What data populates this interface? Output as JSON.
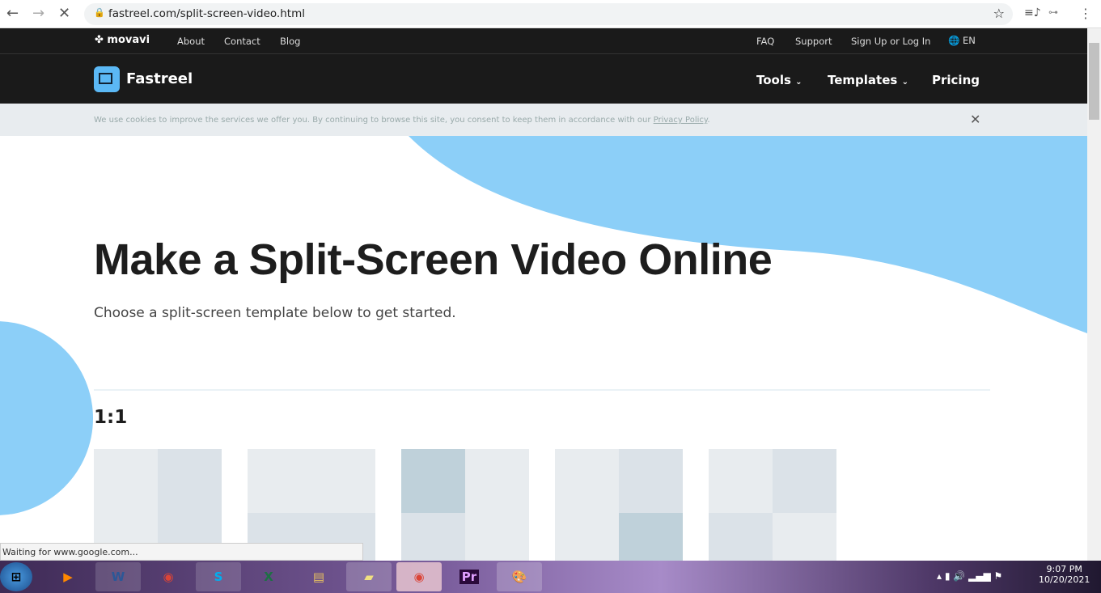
{
  "browser": {
    "url": "fastreel.com/split-screen-video.html",
    "status": "Waiting for www.google.com..."
  },
  "topnav": {
    "logo": "movavi",
    "links": [
      "About",
      "Contact",
      "Blog"
    ],
    "right_links": [
      "FAQ",
      "Support",
      "Sign Up or Log In"
    ],
    "language": "EN"
  },
  "mainnav": {
    "brand": "Fastreel",
    "items": [
      {
        "label": "Tools",
        "dropdown": true
      },
      {
        "label": "Templates",
        "dropdown": true
      },
      {
        "label": "Pricing",
        "dropdown": false
      }
    ]
  },
  "cookie": {
    "text": "We use cookies to improve the services we offer you. By continuing to browse this site, you consent to keep them in accordance with our ",
    "link": "Privacy Policy",
    "suffix": "."
  },
  "hero": {
    "title": "Make a Split-Screen Video Online",
    "subtitle": "Choose a split-screen template below to get started."
  },
  "section": {
    "title": "1:1"
  },
  "colors": {
    "accent": "#8ccff8",
    "dark": "#1a1a1a",
    "tile_light": "#e8ecef",
    "tile_mid": "#dbe2e8",
    "tile_dark": "#bfd1da"
  },
  "taskbar": {
    "time": "9:07 PM",
    "date": "10/20/2021",
    "apps": [
      "start",
      "media-player",
      "word",
      "chrome",
      "skype",
      "excel",
      "file-explorer",
      "sticky-notes",
      "chrome",
      "premiere-pro",
      "paint"
    ]
  }
}
